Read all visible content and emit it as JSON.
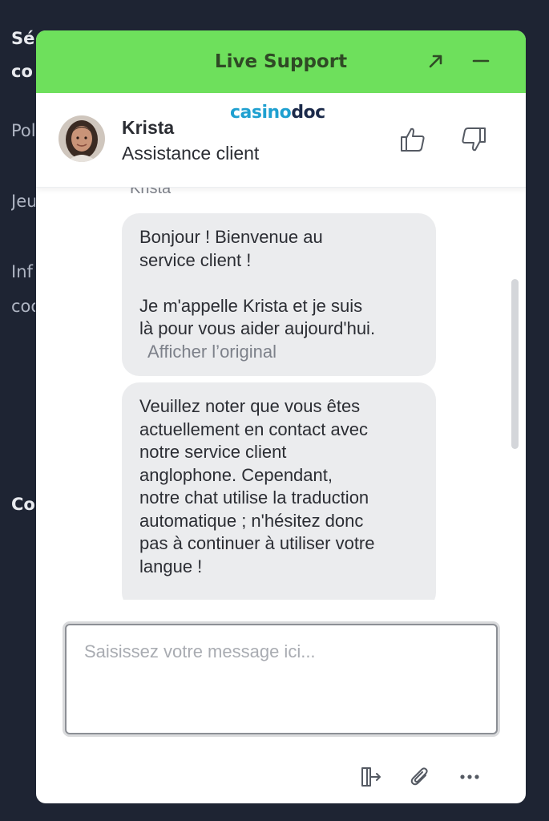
{
  "background_page": {
    "partial_texts": [
      "Séc",
      "co",
      "Pol",
      "Jeu",
      "Inf",
      "coo",
      "Co"
    ]
  },
  "widget": {
    "title": "Live Support",
    "header_color": "#6ee05c",
    "header_icons": [
      "expand-icon",
      "minimize-icon"
    ]
  },
  "agent": {
    "name": "Krista",
    "role": "Assistance client",
    "avatar_icon": "agent-avatar",
    "rating_icons": [
      "thumbs-up-icon",
      "thumbs-down-icon"
    ]
  },
  "brand": {
    "part1": "casino",
    "part2": "doc",
    "colors": [
      "#1fa0d0",
      "#1b2a4a"
    ]
  },
  "messages": {
    "sender": "Krista",
    "bubble1": {
      "lines_a": [
        "Bonjour ! Bienvenue au",
        "service client !"
      ],
      "lines_b": [
        "Je m'appelle Krista et je suis",
        "là pour vous aider aujourd'hui."
      ],
      "show_original": "Afficher l’original"
    },
    "bubble2": {
      "lines": [
        "Veuillez noter que vous êtes",
        "actuellement en contact avec",
        "notre service client",
        "anglophone. Cependant,",
        "notre chat utilise la traduction",
        "automatique ; n'hésitez donc",
        "pas à continuer à utiliser votre",
        "langue !"
      ]
    }
  },
  "composer": {
    "placeholder": "Saisissez votre message ici...",
    "value": ""
  },
  "toolbar_icons": [
    "exit-chat-icon",
    "attachment-icon",
    "more-options-icon"
  ]
}
